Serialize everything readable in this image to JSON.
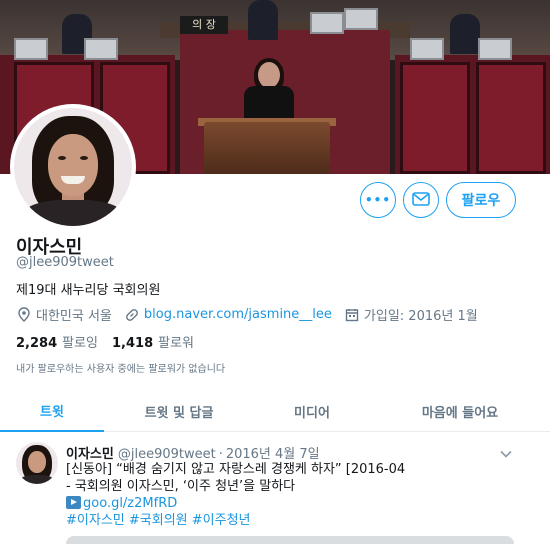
{
  "banner": {
    "nameplate": "의 장"
  },
  "profile": {
    "name": "이자스민",
    "handle": "@jlee909tweet",
    "bio": "제19대 새누리당 국회의원",
    "location": "대한민국 서울",
    "website": "blog.naver.com/jasmine__lee",
    "joined": "가입일: 2016년 1월",
    "following_count": "2,284",
    "following_label": "팔로잉",
    "followers_count": "1,418",
    "followers_label": "팔로워",
    "followers_you_know": "내가 팔로우하는 사용자 중에는 팔로워가 없습니다"
  },
  "actions": {
    "more": "•••",
    "follow": "팔로우"
  },
  "tabs": [
    {
      "label": "트윗",
      "active": true
    },
    {
      "label": "트윗 및 답글",
      "active": false
    },
    {
      "label": "미디어",
      "active": false
    },
    {
      "label": "마음에 들어요",
      "active": false
    }
  ],
  "tweet": {
    "name": "이자스민",
    "handle": "@jlee909tweet",
    "separator": "·",
    "date": "2016년 4월 7일",
    "line1": "[신동아] “배경 숨기지 않고 자랑스레 경쟁케 하자” [2016-04",
    "line2": "- 국회의원 이자스민, ‘이주 청년’을 말하다",
    "link": "goo.gl/z2MfRD",
    "hashtags": [
      "#이자스민",
      "#국회의원",
      "#이주청년"
    ]
  },
  "colors": {
    "accent": "#1da1f2",
    "link": "#1b95e0",
    "secondary_text": "#657786"
  },
  "icons": [
    "location-icon",
    "link-icon",
    "calendar-icon",
    "envelope-icon",
    "more-icon",
    "chevron-down-icon",
    "play-icon"
  ]
}
